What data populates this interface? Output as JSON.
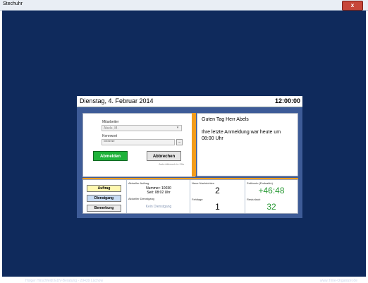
{
  "window": {
    "title": "Stechuhr",
    "close": "x"
  },
  "header": {
    "date": "Dienstag, 4. Februar 2014",
    "time": "12:00:00"
  },
  "login": {
    "user_label": "Mitarbeiter",
    "user_value": "Abels, M.",
    "password_label": "Kennwort",
    "password_value": "********",
    "ellipsis": "...",
    "logout_label": "Abmelden",
    "cancel_label": "Abbrechen",
    "auto_logout": "Auto Abbruch in 29s"
  },
  "greeting": {
    "line1": "Guten Tag Herr Abels",
    "line2": "Ihre letzte Anmeldung war heute um 08:00 Uhr"
  },
  "buttons": {
    "auftrag": "Auftrag",
    "dienstgang": "Dienstgang",
    "bemerkung": "Bemerkung"
  },
  "current_order": {
    "label": "Aktueller Auftrag",
    "number": "Nummer: 10030",
    "since": "Seit: 08:02 Uhr",
    "dienstgang_label": "Aktueller Dienstgang",
    "dienstgang_value": "Kein Dienstgang"
  },
  "messages": {
    "label": "Neue Nachrichten",
    "value": "2",
    "missing_label": "Fehltage",
    "missing_value": "1"
  },
  "account": {
    "label": "Zeitkonto (Endsaldo)",
    "value": "+46:48",
    "vacation_label": "Resturlaub",
    "vacation_value": "32"
  },
  "footer": {
    "left": "Holger Hirschfeldt EDV-Beratung - 29439 Lüchow",
    "right": "www.Time-Organizer.de"
  },
  "colors": {
    "background": "#0f2a5c",
    "panel": "#3d5b97",
    "accent": "#f39c1b",
    "green": "#1fb23a"
  }
}
